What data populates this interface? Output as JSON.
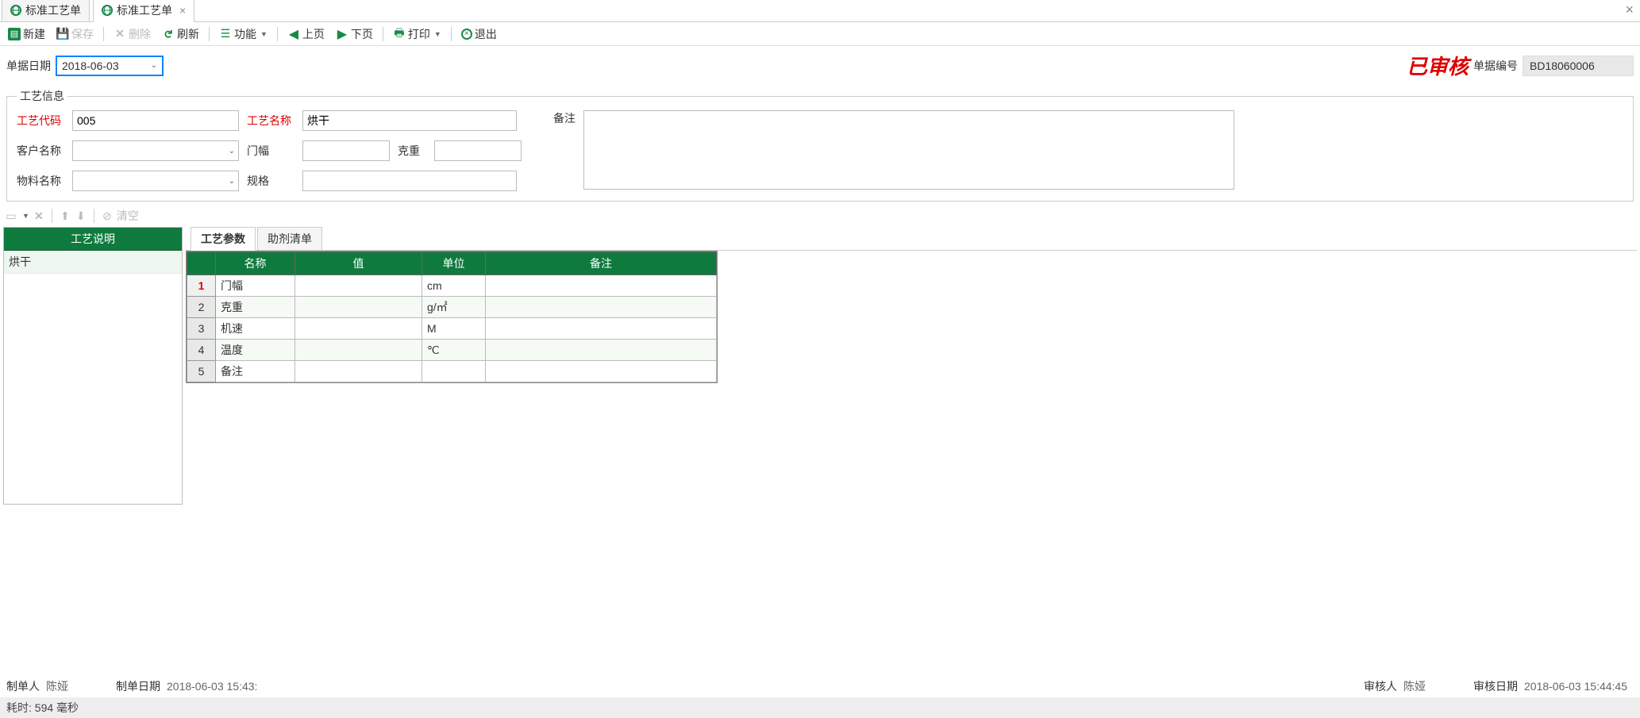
{
  "tabs": {
    "tab1": "标准工艺单",
    "tab2": "标准工艺单"
  },
  "toolbar": {
    "new": "新建",
    "save": "保存",
    "delete": "删除",
    "refresh": "刷新",
    "function": "功能",
    "prev": "上页",
    "next": "下页",
    "print": "打印",
    "exit": "退出"
  },
  "header": {
    "dateLabel": "单据日期",
    "dateValue": "2018-06-03",
    "approved": "已审核",
    "docNoLabel": "单据编号",
    "docNo": "BD18060006"
  },
  "fieldset": {
    "legend": "工艺信息",
    "codeLabel": "工艺代码",
    "code": "005",
    "nameLabel": "工艺名称",
    "name": "烘干",
    "custLabel": "客户名称",
    "cust": "",
    "widthLabel": "门幅",
    "width": "",
    "weightLabel": "克重",
    "weight": "",
    "remarkLabel": "备注",
    "remark": "",
    "matLabel": "物料名称",
    "mat": "",
    "specLabel": "规格",
    "spec": ""
  },
  "midToolbar": {
    "clear": "清空"
  },
  "leftPanel": {
    "header": "工艺说明",
    "row1": "烘干"
  },
  "subTabs": {
    "params": "工艺参数",
    "additive": "助剂清单"
  },
  "grid": {
    "cols": {
      "name": "名称",
      "value": "值",
      "unit": "单位",
      "remark": "备注"
    },
    "rows": [
      {
        "n": "1",
        "name": "门幅",
        "value": "",
        "unit": "cm",
        "remark": ""
      },
      {
        "n": "2",
        "name": "克重",
        "value": "",
        "unit": "g/㎡",
        "remark": ""
      },
      {
        "n": "3",
        "name": "机速",
        "value": "",
        "unit": "M",
        "remark": ""
      },
      {
        "n": "4",
        "name": "温度",
        "value": "",
        "unit": "℃",
        "remark": ""
      },
      {
        "n": "5",
        "name": "备注",
        "value": "",
        "unit": "",
        "remark": ""
      }
    ]
  },
  "footer": {
    "creatorLabel": "制单人",
    "creator": "陈娅",
    "createDateLabel": "制单日期",
    "createDate": "2018-06-03 15:43:",
    "auditorLabel": "审核人",
    "auditor": "陈娅",
    "auditDateLabel": "审核日期",
    "auditDate": "2018-06-03 15:44:45"
  },
  "status": "耗时: 594 毫秒"
}
